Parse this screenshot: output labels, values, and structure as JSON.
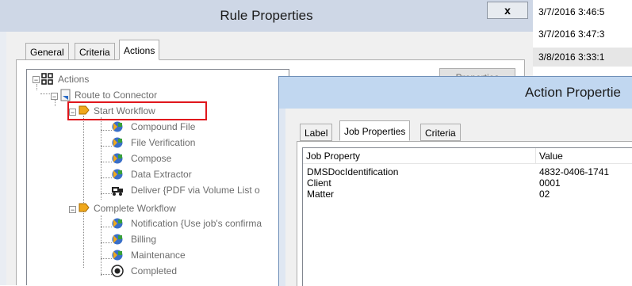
{
  "background_list": {
    "rows": [
      "3/7/2016 3:46:5",
      "3/7/2016 3:47:3",
      "3/8/2016 3:33:1"
    ]
  },
  "rule_properties": {
    "title": "Rule Properties",
    "close_label": "x",
    "tabs": [
      {
        "label": "General"
      },
      {
        "label": "Criteria"
      },
      {
        "label": "Actions",
        "active": true
      }
    ],
    "side_button_label": "Properties",
    "tree": {
      "root": "Actions",
      "route": "Route to Connector",
      "start_workflow": "Start Workflow",
      "start_children": [
        "Compound File",
        "File Verification",
        "Compose",
        "Data Extractor",
        "Deliver {PDF via Volume List o"
      ],
      "complete_workflow": "Complete Workflow",
      "complete_children": [
        "Notification {Use job's confirma",
        "Billing",
        "Maintenance",
        "Completed"
      ]
    },
    "highlight_color": "#e0161c"
  },
  "action_properties": {
    "title": "Action Propertie",
    "tabs": [
      {
        "label": "Label"
      },
      {
        "label": "Job Properties",
        "active": true
      },
      {
        "label": "Criteria"
      }
    ],
    "columns": [
      "Job Property",
      "Value"
    ],
    "rows": [
      {
        "property": "DMSDocIdentification",
        "value": "4832-0406-1741"
      },
      {
        "property": "Client",
        "value": "0001"
      },
      {
        "property": "Matter",
        "value": "02"
      }
    ]
  }
}
